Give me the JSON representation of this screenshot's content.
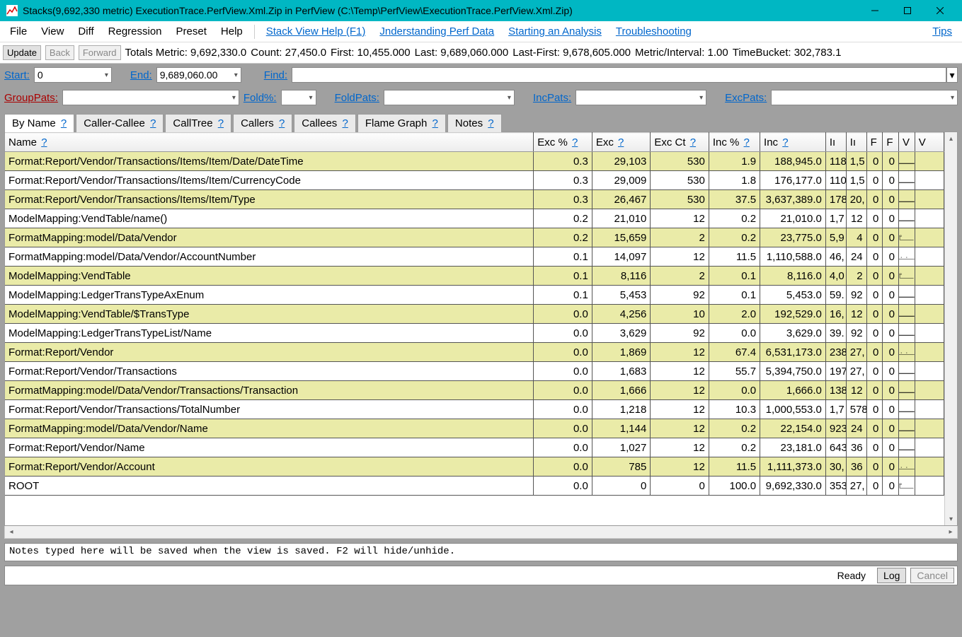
{
  "title": "Stacks(9,692,330 metric) ExecutionTrace.PerfView.Xml.Zip in PerfView (C:\\Temp\\PerfView\\ExecutionTrace.PerfView.Xml.Zip)",
  "menubar": {
    "file": "File",
    "view": "View",
    "diff": "Diff",
    "regression": "Regression",
    "preset": "Preset",
    "help": "Help",
    "links": {
      "stack_help": "Stack View Help (F1)",
      "understanding": "Jnderstanding Perf Data",
      "starting": "Starting an Analysis",
      "troubleshooting": "Troubleshooting",
      "tips": "Tips"
    }
  },
  "stats": {
    "update": "Update",
    "back": "Back",
    "forward": "Forward",
    "totals": "Totals Metric: 9,692,330.0",
    "count": "Count: 27,450.0",
    "first": "First: 10,455.000",
    "last": "Last: 9,689,060.000",
    "lastfirst": "Last-First: 9,678,605.000",
    "metric_interval": "Metric/Interval: 1.00",
    "timebucket": "TimeBucket: 302,783.1"
  },
  "filters": {
    "start_label": "Start:",
    "start_value": "0",
    "end_label": "End:",
    "end_value": "9,689,060.00",
    "find_label": "Find:",
    "find_value": "",
    "grouppats_label": "GroupPats:",
    "grouppats_value": "",
    "fold_label": "Fold%:",
    "fold_value": "",
    "foldpats_label": "FoldPats:",
    "foldpats_value": "",
    "incpats_label": "IncPats:",
    "incpats_value": "",
    "excpats_label": "ExcPats:",
    "excpats_value": ""
  },
  "tabs": {
    "byname": "By Name",
    "caller_callee": "Caller-Callee",
    "calltree": "CallTree",
    "callers": "Callers",
    "callees": "Callees",
    "flame": "Flame Graph",
    "notes": "Notes",
    "q": "?"
  },
  "columns": {
    "name": "Name",
    "excpct": "Exc %",
    "exc": "Exc",
    "excct": "Exc Ct",
    "incpct": "Inc %",
    "inc": "Inc",
    "c7": "Iı",
    "c8": "Iı",
    "c9": "F",
    "c10": "F",
    "c11": "V",
    "c12": "V",
    "q": "?"
  },
  "rows": [
    {
      "name": "Format:Report/Vendor/Transactions/Items/Item/Date/DateTime",
      "excpct": "0.3",
      "exc": "29,103",
      "excct": "530",
      "incpct": "1.9",
      "inc": "188,945.0",
      "c7": "118",
      "c8": "1,5",
      "c9": "0",
      "c10": "0",
      "spark": "flat"
    },
    {
      "name": "Format:Report/Vendor/Transactions/Items/Item/CurrencyCode",
      "excpct": "0.3",
      "exc": "29,009",
      "excct": "530",
      "incpct": "1.8",
      "inc": "176,177.0",
      "c7": "110",
      "c8": "1,5",
      "c9": "0",
      "c10": "0",
      "spark": "flat"
    },
    {
      "name": "Format:Report/Vendor/Transactions/Items/Item/Type",
      "excpct": "0.3",
      "exc": "26,467",
      "excct": "530",
      "incpct": "37.5",
      "inc": "3,637,389.0",
      "c7": "178",
      "c8": "20,",
      "c9": "0",
      "c10": "0",
      "spark": "flat"
    },
    {
      "name": "ModelMapping:VendTable/name()",
      "excpct": "0.2",
      "exc": "21,010",
      "excct": "12",
      "incpct": "0.2",
      "inc": "21,010.0",
      "c7": "1,7",
      "c8": "12",
      "c9": "0",
      "c10": "0",
      "spark": "flat"
    },
    {
      "name": "FormatMapping:model/Data/Vendor",
      "excpct": "0.2",
      "exc": "15,659",
      "excct": "2",
      "incpct": "0.2",
      "inc": "23,775.0",
      "c7": "5,9",
      "c8": "4",
      "c9": "0",
      "c10": "0",
      "spark": "step"
    },
    {
      "name": "FormatMapping:model/Data/Vendor/AccountNumber",
      "excpct": "0.1",
      "exc": "14,097",
      "excct": "12",
      "incpct": "11.5",
      "inc": "1,110,588.0",
      "c7": "46,",
      "c8": "24",
      "c9": "0",
      "c10": "0",
      "spark": "dots"
    },
    {
      "name": "ModelMapping:VendTable",
      "excpct": "0.1",
      "exc": "8,116",
      "excct": "2",
      "incpct": "0.1",
      "inc": "8,116.0",
      "c7": "4,0",
      "c8": "2",
      "c9": "0",
      "c10": "0",
      "spark": "step"
    },
    {
      "name": "ModelMapping:LedgerTransTypeAxEnum",
      "excpct": "0.1",
      "exc": "5,453",
      "excct": "92",
      "incpct": "0.1",
      "inc": "5,453.0",
      "c7": "59.",
      "c8": "92",
      "c9": "0",
      "c10": "0",
      "spark": "flat"
    },
    {
      "name": "ModelMapping:VendTable/$TransType",
      "excpct": "0.0",
      "exc": "4,256",
      "excct": "10",
      "incpct": "2.0",
      "inc": "192,529.0",
      "c7": "16,",
      "c8": "12",
      "c9": "0",
      "c10": "0",
      "spark": "flat"
    },
    {
      "name": "ModelMapping:LedgerTransTypeList/Name",
      "excpct": "0.0",
      "exc": "3,629",
      "excct": "92",
      "incpct": "0.0",
      "inc": "3,629.0",
      "c7": "39.",
      "c8": "92",
      "c9": "0",
      "c10": "0",
      "spark": "flat"
    },
    {
      "name": "Format:Report/Vendor",
      "excpct": "0.0",
      "exc": "1,869",
      "excct": "12",
      "incpct": "67.4",
      "inc": "6,531,173.0",
      "c7": "238",
      "c8": "27,",
      "c9": "0",
      "c10": "0",
      "spark": "dots"
    },
    {
      "name": "Format:Report/Vendor/Transactions",
      "excpct": "0.0",
      "exc": "1,683",
      "excct": "12",
      "incpct": "55.7",
      "inc": "5,394,750.0",
      "c7": "197",
      "c8": "27,",
      "c9": "0",
      "c10": "0",
      "spark": "flat"
    },
    {
      "name": "FormatMapping:model/Data/Vendor/Transactions/Transaction",
      "excpct": "0.0",
      "exc": "1,666",
      "excct": "12",
      "incpct": "0.0",
      "inc": "1,666.0",
      "c7": "138",
      "c8": "12",
      "c9": "0",
      "c10": "0",
      "spark": "flat"
    },
    {
      "name": "Format:Report/Vendor/Transactions/TotalNumber",
      "excpct": "0.0",
      "exc": "1,218",
      "excct": "12",
      "incpct": "10.3",
      "inc": "1,000,553.0",
      "c7": "1,7",
      "c8": "578",
      "c9": "0",
      "c10": "0",
      "spark": "flat"
    },
    {
      "name": "FormatMapping:model/Data/Vendor/Name",
      "excpct": "0.0",
      "exc": "1,144",
      "excct": "12",
      "incpct": "0.2",
      "inc": "22,154.0",
      "c7": "923",
      "c8": "24",
      "c9": "0",
      "c10": "0",
      "spark": "flat"
    },
    {
      "name": "Format:Report/Vendor/Name",
      "excpct": "0.0",
      "exc": "1,027",
      "excct": "12",
      "incpct": "0.2",
      "inc": "23,181.0",
      "c7": "643",
      "c8": "36",
      "c9": "0",
      "c10": "0",
      "spark": "flat"
    },
    {
      "name": "Format:Report/Vendor/Account",
      "excpct": "0.0",
      "exc": "785",
      "excct": "12",
      "incpct": "11.5",
      "inc": "1,111,373.0",
      "c7": "30,",
      "c8": "36",
      "c9": "0",
      "c10": "0",
      "spark": "dots"
    },
    {
      "name": "ROOT",
      "excpct": "0.0",
      "exc": "0",
      "excct": "0",
      "incpct": "100.0",
      "inc": "9,692,330.0",
      "c7": "353",
      "c8": "27,",
      "c9": "0",
      "c10": "0",
      "spark": "step"
    }
  ],
  "notes_placeholder": "Notes typed here will be saved when the view is saved. F2 will hide/unhide.",
  "statusbar": {
    "ready": "Ready",
    "log": "Log",
    "cancel": "Cancel"
  }
}
